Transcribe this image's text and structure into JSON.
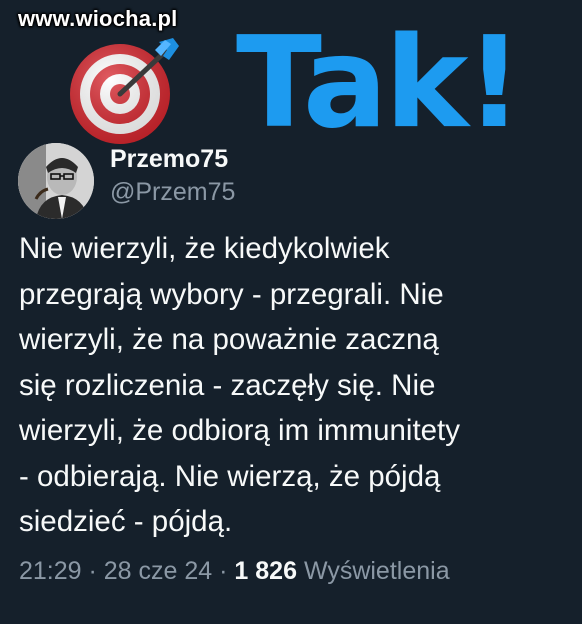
{
  "watermark": {
    "text": "www.wiocha.pl"
  },
  "overlay": {
    "headline": "Tak!",
    "icon": "target-with-arrow-icon",
    "headline_color": "#1d9bf0"
  },
  "tweet": {
    "author": {
      "display_name": "Przemo75",
      "handle": "@Przem75",
      "avatar_icon": "profile-photo"
    },
    "text_lines": [
      "Nie wierzyli, że kiedykolwiek",
      "przegrają wybory - przegrali. Nie",
      "wierzyli, że na poważnie zaczną",
      "się rozliczenia - zaczęły się. Nie",
      "wierzyli, że odbiorą im immunitety",
      "- odbierają. Nie wierzą, że pójdą",
      "siedzieć - pójdą."
    ],
    "meta": {
      "time": "21:29",
      "separator": " · ",
      "date": "28 cze 24",
      "views_count": "1 826",
      "views_label": "Wyświetlenia"
    }
  },
  "theme": {
    "background": "#15202b",
    "text_primary": "#f7f9f9",
    "text_secondary": "#8b98a5"
  }
}
